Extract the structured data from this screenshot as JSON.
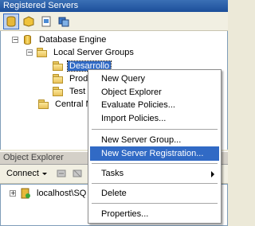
{
  "registered_servers": {
    "title": "Registered Servers",
    "toolbar_icons": [
      "database-engine-icon",
      "analysis-services-icon",
      "reporting-services-icon",
      "integration-services-icon"
    ],
    "tree": {
      "root": "Database Engine",
      "group": "Local Server Groups",
      "items": [
        "Desarrollo",
        "Prod",
        "Test"
      ],
      "central": "Central M"
    }
  },
  "context_menu": {
    "items": [
      {
        "label": "New Query"
      },
      {
        "label": "Object Explorer"
      },
      {
        "label": "Evaluate Policies..."
      },
      {
        "label": "Import Policies..."
      },
      {
        "label": "New Server Group..."
      },
      {
        "label": "New Server Registration..."
      },
      {
        "label": "Tasks"
      },
      {
        "label": "Delete"
      },
      {
        "label": "Properties..."
      }
    ]
  },
  "object_explorer": {
    "title": "Object Explorer",
    "connect_label": "Connect",
    "server_node": "localhost\\SQ"
  },
  "colors": {
    "selection": "#316ac5",
    "title_bar": "#2a5fa8"
  }
}
